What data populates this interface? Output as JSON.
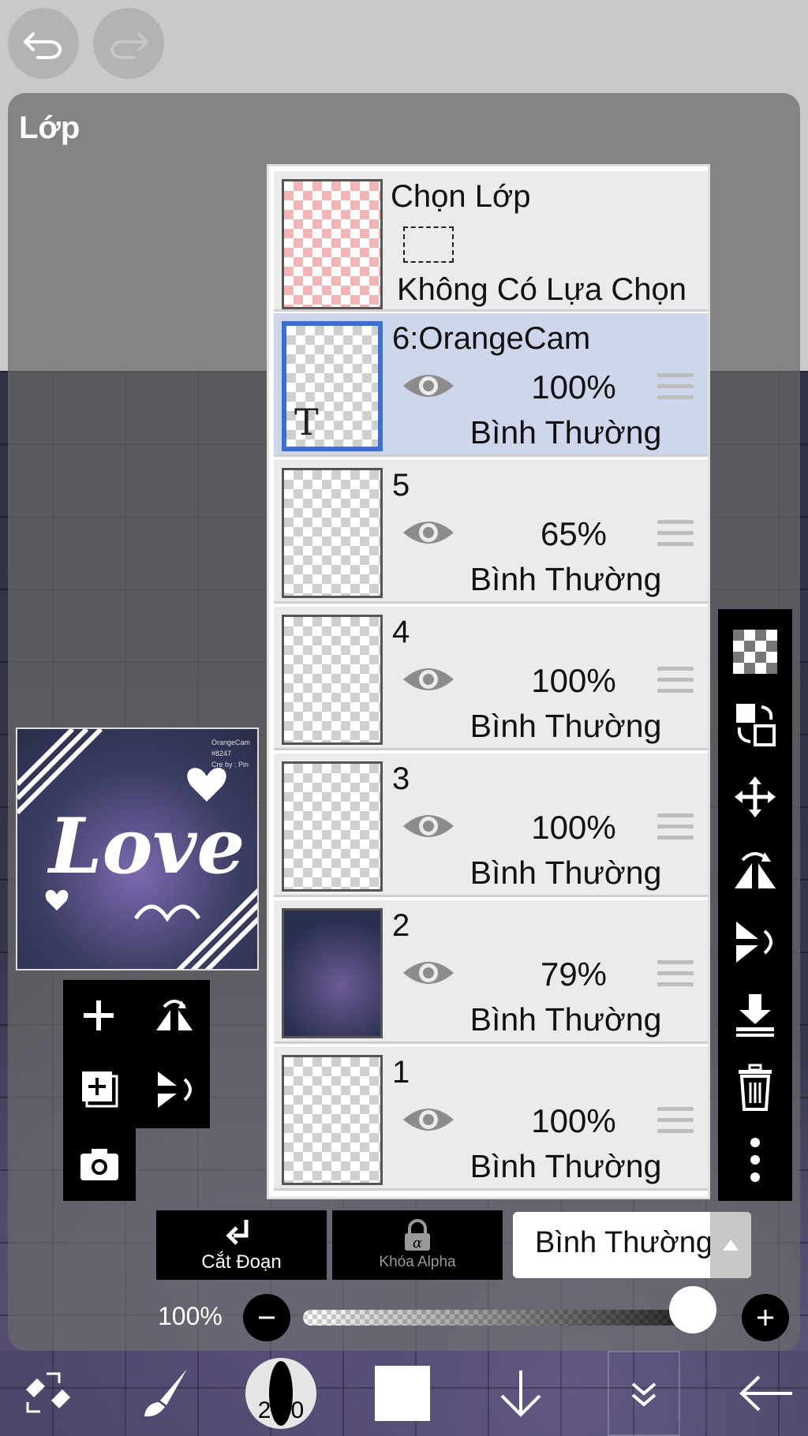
{
  "panel": {
    "title": "Lớp"
  },
  "selection_row": {
    "title": "Chọn Lớp",
    "status": "Không Có Lựa Chọn"
  },
  "layers": [
    {
      "name": "6:OrangeCam",
      "opacity": "100%",
      "blend": "Bình Thường",
      "selected": true,
      "thumb_icon": "text-layer-icon",
      "thumb_glyph": "T"
    },
    {
      "name": "5",
      "opacity": "65%",
      "blend": "Bình Thường",
      "selected": false
    },
    {
      "name": "4",
      "opacity": "100%",
      "blend": "Bình Thường",
      "selected": false
    },
    {
      "name": "3",
      "opacity": "100%",
      "blend": "Bình Thường",
      "selected": false
    },
    {
      "name": "2",
      "opacity": "79%",
      "blend": "Bình Thường",
      "selected": false
    },
    {
      "name": "1",
      "opacity": "100%",
      "blend": "Bình Thường",
      "selected": false
    }
  ],
  "bottom_bar": {
    "clip_label": "Cắt Đoạn",
    "alpha_lock_label": "Khóa Alpha",
    "blend_mode": "Bình Thường"
  },
  "opacity_slider": {
    "label": "100%",
    "value": 1.0
  },
  "brush_size": "25.0",
  "preview": {
    "title_text": "Love",
    "caption_lines": [
      "OrangeCam",
      "#8247",
      "Cre by : Pin"
    ]
  },
  "icons": {
    "undo": "undo-icon",
    "redo": "redo-icon",
    "eye": "eye-icon",
    "drag_handle": "drag-handle-icon",
    "checker": "transparency-icon",
    "move": "move-icon",
    "trash": "trash-icon",
    "more": "more-vertical-icon"
  },
  "colors": {
    "selected_row": "#cdd6ea",
    "selected_border": "#3b6fd6",
    "panel_overlay": "#696969"
  }
}
